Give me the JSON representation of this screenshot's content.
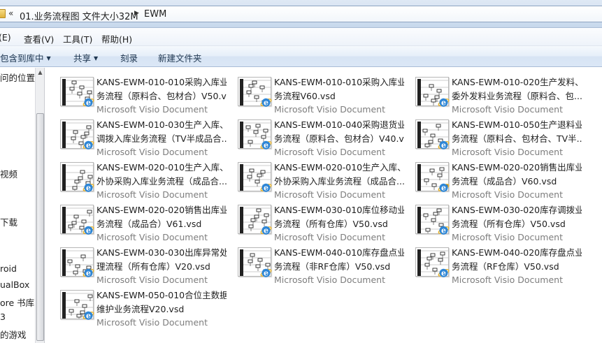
{
  "address": {
    "segments": [
      "01.业务流程图 文件大小32M",
      "EWM"
    ]
  },
  "menu": {
    "items": [
      "(E)",
      "查看(V)",
      "工具(T)",
      "帮助(H)"
    ]
  },
  "toolbar": {
    "buttons": [
      "包含到库中",
      "共享",
      "刻录",
      "新建文件夹"
    ]
  },
  "nav": {
    "items": [
      "问的位置",
      "视频",
      "下载",
      "roid",
      "ualBox",
      "ore 书库",
      "3",
      "的游戏"
    ]
  },
  "files": [
    {
      "line1": "KANS-EWM-010-010采购入库业",
      "line2": "务流程（原料合、包材合）V50.v...",
      "type": "Microsoft Visio Document"
    },
    {
      "line1": "KANS-EWM-010-010采购入库业",
      "line2": "务流程V60.vsd",
      "type": "Microsoft Visio Document"
    },
    {
      "line1": "KANS-EWM-010-020生产发料、",
      "line2": "委外发料业务流程（原料合、包...",
      "type": "Microsoft Visio Document"
    },
    {
      "line1": "KANS-EWM-010-030生产入库、",
      "line2": "调拨入库业务流程（TV半成品合...",
      "type": "Microsoft Visio Document"
    },
    {
      "line1": "KANS-EWM-010-040采购退货业",
      "line2": "务流程（原料合、包材合）V40.v...",
      "type": "Microsoft Visio Document"
    },
    {
      "line1": "KANS-EWM-010-050生产退料业",
      "line2": "务流程（原料合、包材合、TV半...",
      "type": "Microsoft Visio Document"
    },
    {
      "line1": "KANS-EWM-020-010生产入库、",
      "line2": "外协采购入库业务流程（成品合...",
      "type": "Microsoft Visio Document"
    },
    {
      "line1": "KANS-EWM-020-010生产入库、",
      "line2": "外协采购入库业务流程（成品合...",
      "type": "Microsoft Visio Document"
    },
    {
      "line1": "KANS-EWM-020-020销售出库业",
      "line2": "务流程（成品合）V60.vsd",
      "type": "Microsoft Visio Document"
    },
    {
      "line1": "KANS-EWM-020-020销售出库业",
      "line2": "务流程（成品合）V61.vsd",
      "type": "Microsoft Visio Document"
    },
    {
      "line1": "KANS-EWM-030-010库位移动业",
      "line2": "务流程（所有仓库）V50.vsd",
      "type": "Microsoft Visio Document"
    },
    {
      "line1": "KANS-EWM-030-020库存调拨业",
      "line2": "务流程（所有仓库）V50.vsd",
      "type": "Microsoft Visio Document"
    },
    {
      "line1": "KANS-EWM-030-030出库异常处",
      "line2": "理流程（所有仓库）V20.vsd",
      "type": "Microsoft Visio Document"
    },
    {
      "line1": "KANS-EWM-040-010库存盘点业",
      "line2": "务流程（非RF仓库）V50.vsd",
      "type": "Microsoft Visio Document"
    },
    {
      "line1": "KANS-EWM-040-020库存盘点业",
      "line2": "务流程（RF仓库）V50.vsd",
      "type": "Microsoft Visio Document"
    },
    {
      "line1": "KANS-EWM-050-010合位主数据",
      "line2": "维护业务流程V20.vsd",
      "type": "Microsoft Visio Document"
    }
  ],
  "icons": {
    "file_overlay": "internet-explorer-icon",
    "thumbnail": "visio-diagram-thumbnail",
    "address_folder": "folder-icon"
  }
}
